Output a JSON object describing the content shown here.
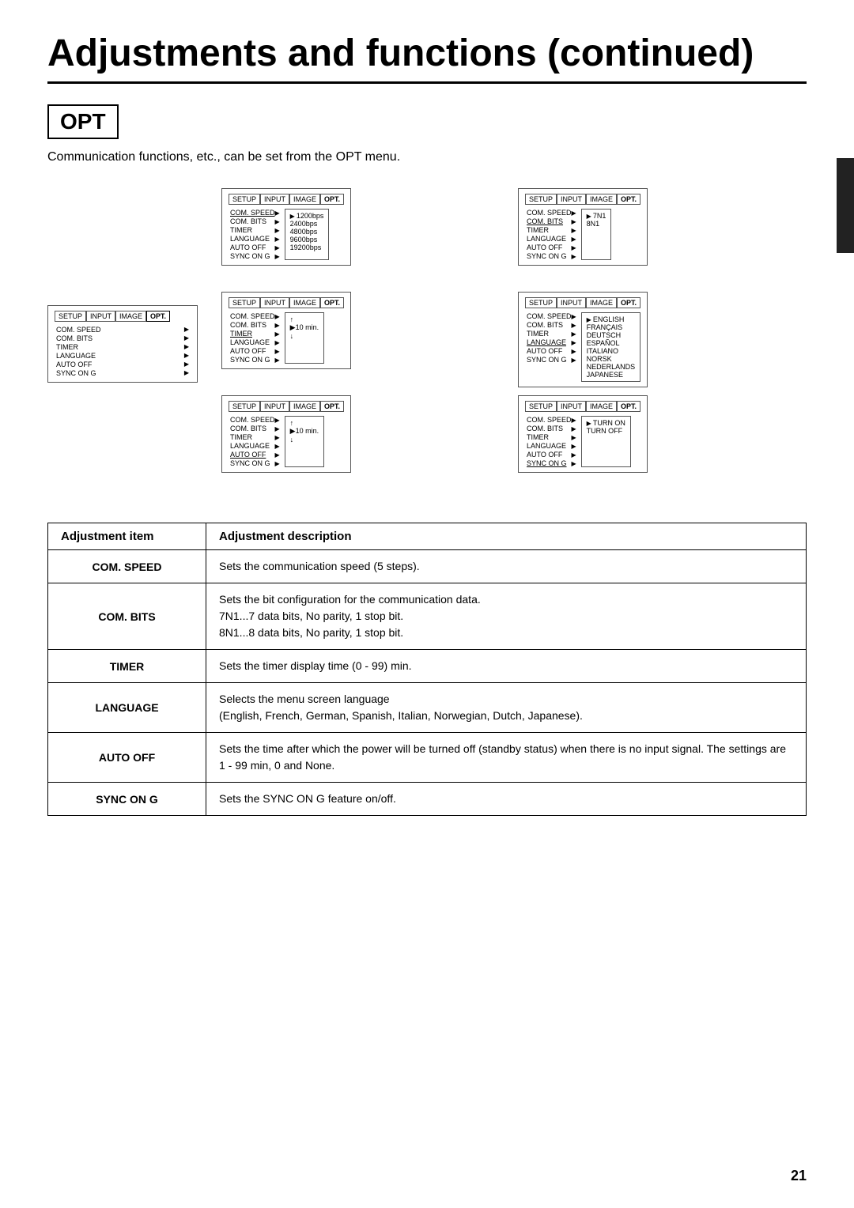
{
  "page": {
    "title": "Adjustments and functions (continued)",
    "opt_label": "OPT",
    "intro": "Communication functions, etc., can be set from the OPT menu.",
    "page_number": "21"
  },
  "diagrams": {
    "main_menu": {
      "tabs": [
        "SETUP",
        "INPUT",
        "IMAGE",
        "OPT."
      ],
      "items": [
        "COM. SPEED",
        "COM. BITS",
        "TIMER",
        "LANGUAGE",
        "AUTO OFF",
        "SYNC ON G"
      ]
    },
    "com_speed_menu": {
      "tabs": [
        "SETUP",
        "INPUT",
        "IMAGE",
        "OPT."
      ],
      "items": [
        "COM. SPEED",
        "COM. BITS",
        "TIMER",
        "LANGUAGE",
        "AUTO OFF",
        "SYNC ON G"
      ],
      "submenu": [
        "1200bps",
        "2400bps",
        "4800bps",
        "9600bps",
        "19200bps"
      ],
      "selected": "1200bps"
    },
    "timer_menu": {
      "tabs": [
        "SETUP",
        "INPUT",
        "IMAGE",
        "OPT."
      ],
      "items": [
        "COM. SPEED",
        "COM. BITS",
        "TIMER",
        "LANGUAGE",
        "AUTO OFF",
        "SYNC ON G"
      ],
      "submenu_label": "10 min.",
      "has_arrows": true
    },
    "com_bits_menu": {
      "tabs": [
        "SETUP",
        "INPUT",
        "IMAGE",
        "OPT."
      ],
      "items": [
        "COM. SPEED",
        "COM. BITS",
        "TIMER",
        "LANGUAGE",
        "AUTO OFF",
        "SYNC ON G"
      ],
      "submenu": [
        "7N1",
        "8N1"
      ],
      "selected": "7N1"
    },
    "language_menu": {
      "tabs": [
        "SETUP",
        "INPUT",
        "IMAGE",
        "OPT."
      ],
      "items": [
        "COM. SPEED",
        "COM. BITS",
        "TIMER",
        "LANGUAGE",
        "AUTO OFF",
        "SYNC ON G"
      ],
      "submenu": [
        "ENGLISH",
        "FRANÇAIS",
        "DEUTSCH",
        "ESPAÑOL",
        "ITALIANO",
        "NORSK",
        "NEDERLANDS",
        "JAPANESE"
      ],
      "selected": "ENGLISH"
    },
    "auto_off_menu": {
      "tabs": [
        "SETUP",
        "INPUT",
        "IMAGE",
        "OPT."
      ],
      "items": [
        "COM. SPEED",
        "COM. BITS",
        "TIMER",
        "LANGUAGE",
        "AUTO OFF",
        "SYNC ON G"
      ],
      "submenu_label": "10 min.",
      "has_arrows": true
    },
    "sync_on_g_menu": {
      "tabs": [
        "SETUP",
        "INPUT",
        "IMAGE",
        "OPT."
      ],
      "items": [
        "COM. SPEED",
        "COM. BITS",
        "TIMER",
        "LANGUAGE",
        "AUTO OFF",
        "SYNC ON G"
      ],
      "submenu": [
        "TURN ON",
        "TURN OFF"
      ],
      "selected": "TURN ON"
    }
  },
  "table": {
    "header": {
      "col1": "Adjustment item",
      "col2": "Adjustment description"
    },
    "rows": [
      {
        "label": "COM. SPEED",
        "desc": "Sets the communication speed (5 steps)."
      },
      {
        "label": "COM. BITS",
        "desc": "Sets the bit configuration for the communication data.\n7N1...7 data bits, No parity, 1 stop bit.\n8N1...8 data bits, No parity, 1 stop bit."
      },
      {
        "label": "TIMER",
        "desc": "Sets the timer display time (0 - 99) min."
      },
      {
        "label": "LANGUAGE",
        "desc": "Selects the menu screen language\n(English, French, German, Spanish, Italian, Norwegian, Dutch, Japanese)."
      },
      {
        "label": "AUTO OFF",
        "desc": "Sets the time after which the power will be turned off (standby status) when there is no input signal. The settings are 1 - 99 min, 0 and None."
      },
      {
        "label": "SYNC ON G",
        "desc": "Sets the SYNC ON G feature on/off."
      }
    ]
  }
}
